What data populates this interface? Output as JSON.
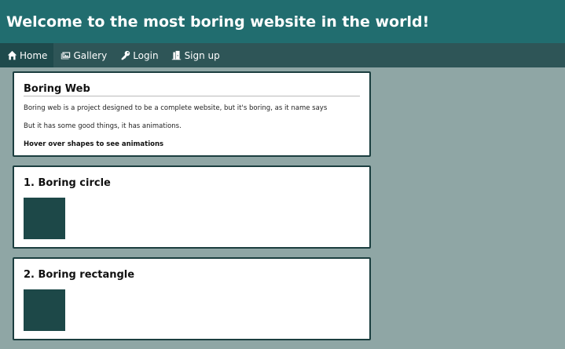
{
  "header": {
    "title": "Welcome to the most boring website in the world!"
  },
  "nav": {
    "items": [
      {
        "label": "Home",
        "icon": "home-icon"
      },
      {
        "label": "Gallery",
        "icon": "gallery-icon"
      },
      {
        "label": "Login",
        "icon": "key-icon"
      },
      {
        "label": "Sign up",
        "icon": "door-icon"
      }
    ]
  },
  "intro": {
    "title": "Boring Web",
    "paragraph1": "Boring web is a project designed to be a complete website, but it's boring, as it name says",
    "paragraph2": "But it has some good things, it has animations.",
    "paragraph3": "Hover over shapes to see animations"
  },
  "shapes": [
    {
      "title": "1. Boring circle"
    },
    {
      "title": "2. Boring rectangle"
    }
  ],
  "colors": {
    "header_bg": "#216d6f",
    "nav_bg": "#2e5557",
    "page_bg": "#8fa6a5",
    "shape": "#1d4848"
  }
}
